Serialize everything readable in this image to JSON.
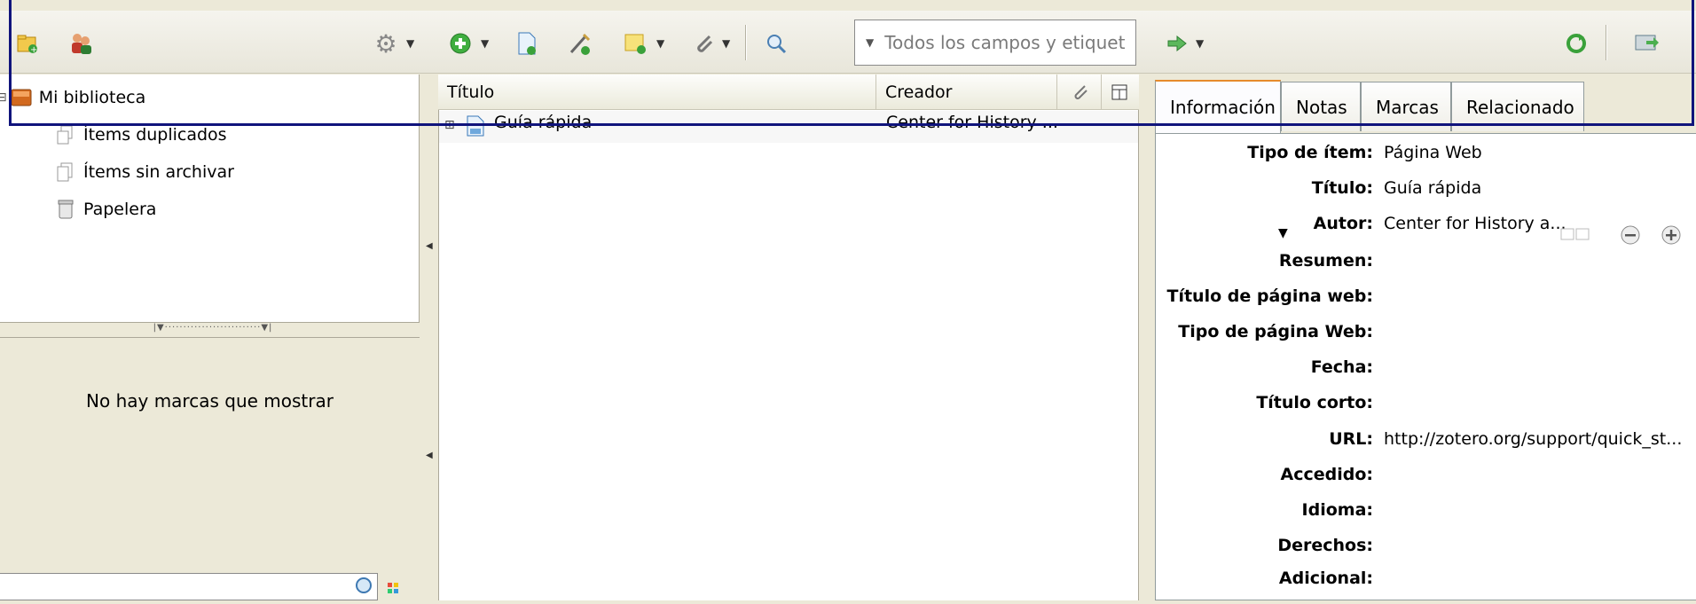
{
  "toolbar": {
    "icons": [
      "new-collection-icon",
      "new-group-icon",
      "gear-icon",
      "new-item-icon",
      "new-note-doc-icon",
      "add-by-identifier-icon",
      "new-note-icon",
      "attachment-icon",
      "advanced-search-icon",
      "locate-icon",
      "sync-icon",
      "fullscreen-icon"
    ],
    "search_placeholder": "Todos los campos y etiquet"
  },
  "collections": {
    "library": "Mi biblioteca",
    "items": [
      {
        "label": "Ítems duplicados",
        "icon": "duplicates-icon"
      },
      {
        "label": "Ítems sin archivar",
        "icon": "unfiled-icon"
      },
      {
        "label": "Papelera",
        "icon": "trash-icon"
      }
    ]
  },
  "tags": {
    "empty_message": "No hay marcas que mostrar"
  },
  "items_table": {
    "columns": [
      "Título",
      "Creador"
    ],
    "rows": [
      {
        "title": "Guía rápida",
        "creator": "Center for History ..."
      }
    ]
  },
  "item_pane": {
    "tabs": [
      "Información",
      "Notas",
      "Marcas",
      "Relacionado"
    ],
    "selected_tab": "Información",
    "fields": [
      {
        "label": "Tipo de ítem:",
        "value": "Página Web"
      },
      {
        "label": "Título:",
        "value": "Guía rápida"
      },
      {
        "label": "Autor:",
        "value": "Center for History a..."
      },
      {
        "label": "Resumen:",
        "value": ""
      },
      {
        "label": "Título de página web:",
        "value": ""
      },
      {
        "label": "Tipo de página Web:",
        "value": ""
      },
      {
        "label": "Fecha:",
        "value": ""
      },
      {
        "label": "Título corto:",
        "value": ""
      },
      {
        "label": "URL:",
        "value": "http://zotero.org/support/quick_st..."
      },
      {
        "label": "Accedido:",
        "value": ""
      },
      {
        "label": "Idioma:",
        "value": ""
      },
      {
        "label": "Derechos:",
        "value": ""
      },
      {
        "label": "Adicional:",
        "value": ""
      }
    ]
  },
  "colors": {
    "highlight_box": "#10147c",
    "tab_accent": "#e68b2c"
  }
}
